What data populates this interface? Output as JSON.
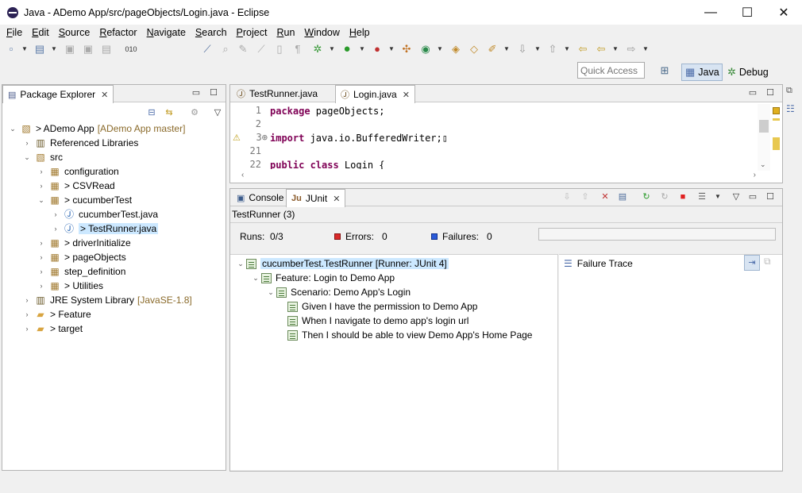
{
  "window": {
    "title": "Java - ADemo App/src/pageObjects/Login.java - Eclipse",
    "minimize": "—",
    "maximize": "☐",
    "close": "✕"
  },
  "menu": [
    "File",
    "Edit",
    "Source",
    "Refactor",
    "Navigate",
    "Search",
    "Project",
    "Run",
    "Window",
    "Help"
  ],
  "toolbar": {
    "quick_access_placeholder": "Quick Access",
    "perspectives": [
      {
        "label": "Java",
        "icon": "java-perspective-icon",
        "active": true
      },
      {
        "label": "Debug",
        "icon": "debug-perspective-icon",
        "active": false
      }
    ]
  },
  "package_explorer": {
    "tab_label": "Package Explorer",
    "tree": [
      {
        "label": "> ADemo App",
        "decoration": "[ADemo App master]",
        "icon": "java-project-icon",
        "expanded": true
      },
      {
        "label": "Referenced Libraries",
        "icon": "library-icon"
      },
      {
        "label": "src",
        "icon": "source-folder-icon",
        "expanded": true
      },
      {
        "label": "configuration",
        "icon": "package-icon"
      },
      {
        "label": "> CSVRead",
        "icon": "package-icon"
      },
      {
        "label": "> cucumberTest",
        "icon": "package-icon",
        "expanded": true
      },
      {
        "label": "cucumberTest.java",
        "icon": "java-file-icon"
      },
      {
        "label": "> TestRunner.java",
        "icon": "java-file-icon",
        "selected": true
      },
      {
        "label": "> driverInitialize",
        "icon": "package-icon"
      },
      {
        "label": "> pageObjects",
        "icon": "package-icon"
      },
      {
        "label": "step_definition",
        "icon": "package-icon"
      },
      {
        "label": "> Utilities",
        "icon": "package-icon"
      },
      {
        "label": "JRE System Library",
        "decoration": "[JavaSE-1.8]",
        "icon": "library-icon"
      },
      {
        "label": "> Feature",
        "icon": "folder-icon"
      },
      {
        "label": "> target",
        "icon": "folder-icon"
      }
    ]
  },
  "editor": {
    "tabs": [
      {
        "label": "TestRunner.java",
        "selected": false
      },
      {
        "label": "Login.java",
        "selected": true
      }
    ],
    "lines": [
      {
        "num": "1",
        "kw": "package",
        "rest": " pageObjects;"
      },
      {
        "num": "2",
        "kw": "",
        "rest": ""
      },
      {
        "num": "3⊕",
        "kw": "import",
        "rest": " java.io.BufferedWriter;▯"
      },
      {
        "num": "21",
        "kw": "",
        "rest": ""
      },
      {
        "num": "22",
        "kw": "public class",
        "rest": " Login {"
      }
    ]
  },
  "bottom": {
    "tabs": [
      {
        "label": "Console",
        "selected": false
      },
      {
        "label": "JUnit",
        "selected": true
      }
    ],
    "junit": {
      "run_name": "TestRunner (3)",
      "runs_label": "Runs:",
      "runs_value": "0/3",
      "errors_label": "Errors:",
      "errors_value": "0",
      "failures_label": "Failures:",
      "failures_value": "0",
      "progress": 0,
      "tree": [
        {
          "label": "cucumberTest.TestRunner [Runner: JUnit 4]",
          "selected": true
        },
        {
          "label": "Feature: Login to Demo App"
        },
        {
          "label": "Scenario: Demo App's Login"
        },
        {
          "label": "Given I have the permission to Demo App"
        },
        {
          "label": "When I navigate to demo app's login url"
        },
        {
          "label": "Then I should be able to view Demo App's Home Page"
        }
      ],
      "failure_trace_label": "Failure Trace"
    }
  },
  "colors": {
    "selection": "#cce8ff",
    "keyword": "#7f0055",
    "error_red": "#d92a2a",
    "failure_blue": "#2a5ad9",
    "stop_red": "#e02020"
  }
}
